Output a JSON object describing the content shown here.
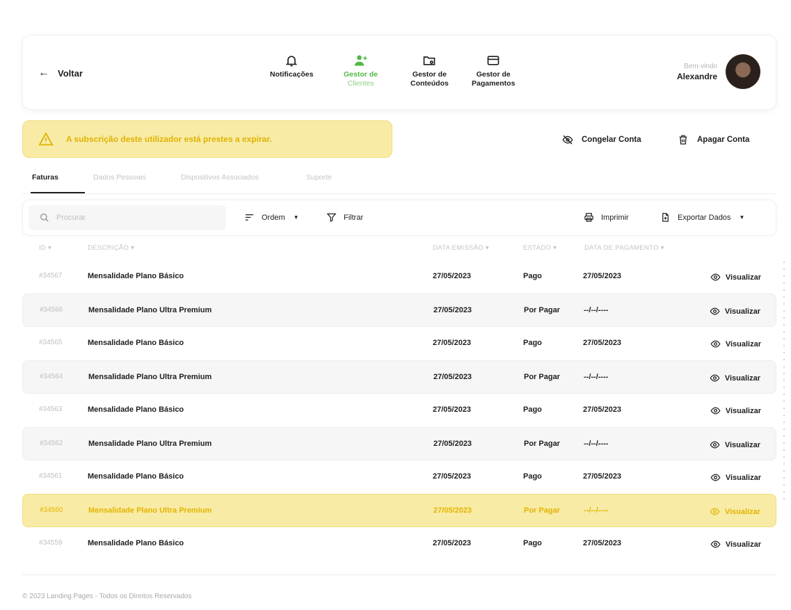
{
  "header": {
    "back_label": "Voltar",
    "nav": [
      {
        "label_1": "Notificações",
        "label_2": "",
        "icon": "bell-icon"
      },
      {
        "label_1": "Gestor de",
        "label_2": "Clientes",
        "icon": "users-icon",
        "active": true
      },
      {
        "label_1": "Gestor de",
        "label_2": "Conteúdos",
        "icon": "folder-icon"
      },
      {
        "label_1": "Gestor de",
        "label_2": "Pagamentos",
        "icon": "credit-card-icon"
      }
    ],
    "welcome": "Bem-vindo",
    "user_name": "Alexandre"
  },
  "alert": {
    "text": "A subscrição deste utilizador está prestes a expirar."
  },
  "actions": {
    "freeze_label": "Congelar Conta",
    "delete_label": "Apagar Conta"
  },
  "tabs": [
    "Faturas",
    "Dados Pessoais",
    "Dispositivos Associados",
    "Suporte"
  ],
  "toolbar": {
    "search_placeholder": "Procurar",
    "order_label": "Ordem",
    "filter_label": "Filtrar",
    "print_label": "Imprimir",
    "export_label": "Exportar Dados"
  },
  "table": {
    "columns": {
      "id": "ID ▾",
      "description": "DESCRIÇÃO ▾",
      "issue_date": "DATA EMISSÃO ▾",
      "state": "ESTADO ▾",
      "payment_date": "DATA DE PAGAMENTO ▾"
    },
    "view_label": "Visualizar",
    "rows": [
      {
        "id": "#34567",
        "description": "Mensalidade Plano Básico",
        "issue_date": "27/05/2023",
        "state": "Pago",
        "payment_date": "27/05/2023"
      },
      {
        "id": "#34566",
        "description": "Mensalidade Plano Ultra Premium",
        "issue_date": "27/05/2023",
        "state": "Por Pagar",
        "payment_date": "--/--/----"
      },
      {
        "id": "#34565",
        "description": "Mensalidade Plano Básico",
        "issue_date": "27/05/2023",
        "state": "Pago",
        "payment_date": "27/05/2023"
      },
      {
        "id": "#34564",
        "description": "Mensalidade Plano Ultra Premium",
        "issue_date": "27/05/2023",
        "state": "Por Pagar",
        "payment_date": "--/--/----"
      },
      {
        "id": "#34563",
        "description": "Mensalidade Plano Básico",
        "issue_date": "27/05/2023",
        "state": "Pago",
        "payment_date": "27/05/2023"
      },
      {
        "id": "#34562",
        "description": "Mensalidade Plano Ultra Premium",
        "issue_date": "27/05/2023",
        "state": "Por Pagar",
        "payment_date": "--/--/----"
      },
      {
        "id": "#34561",
        "description": "Mensalidade Plano Básico",
        "issue_date": "27/05/2023",
        "state": "Pago",
        "payment_date": "27/05/2023"
      },
      {
        "id": "#34560",
        "description": "Mensalidade Plano Ultra Premium",
        "issue_date": "27/05/2023",
        "state": "Por Pagar",
        "payment_date": "--/--/----"
      },
      {
        "id": "#34559",
        "description": "Mensalidade Plano Básico",
        "issue_date": "27/05/2023",
        "state": "Pago",
        "payment_date": "27/05/2023"
      }
    ]
  },
  "footer": {
    "text": "© 2023 Landing Pages - Todos os Direitos Reservados"
  },
  "colors": {
    "accent_green": "#54b848",
    "warning_yellow": "#e0b300",
    "warning_bg": "#f8eba5"
  }
}
